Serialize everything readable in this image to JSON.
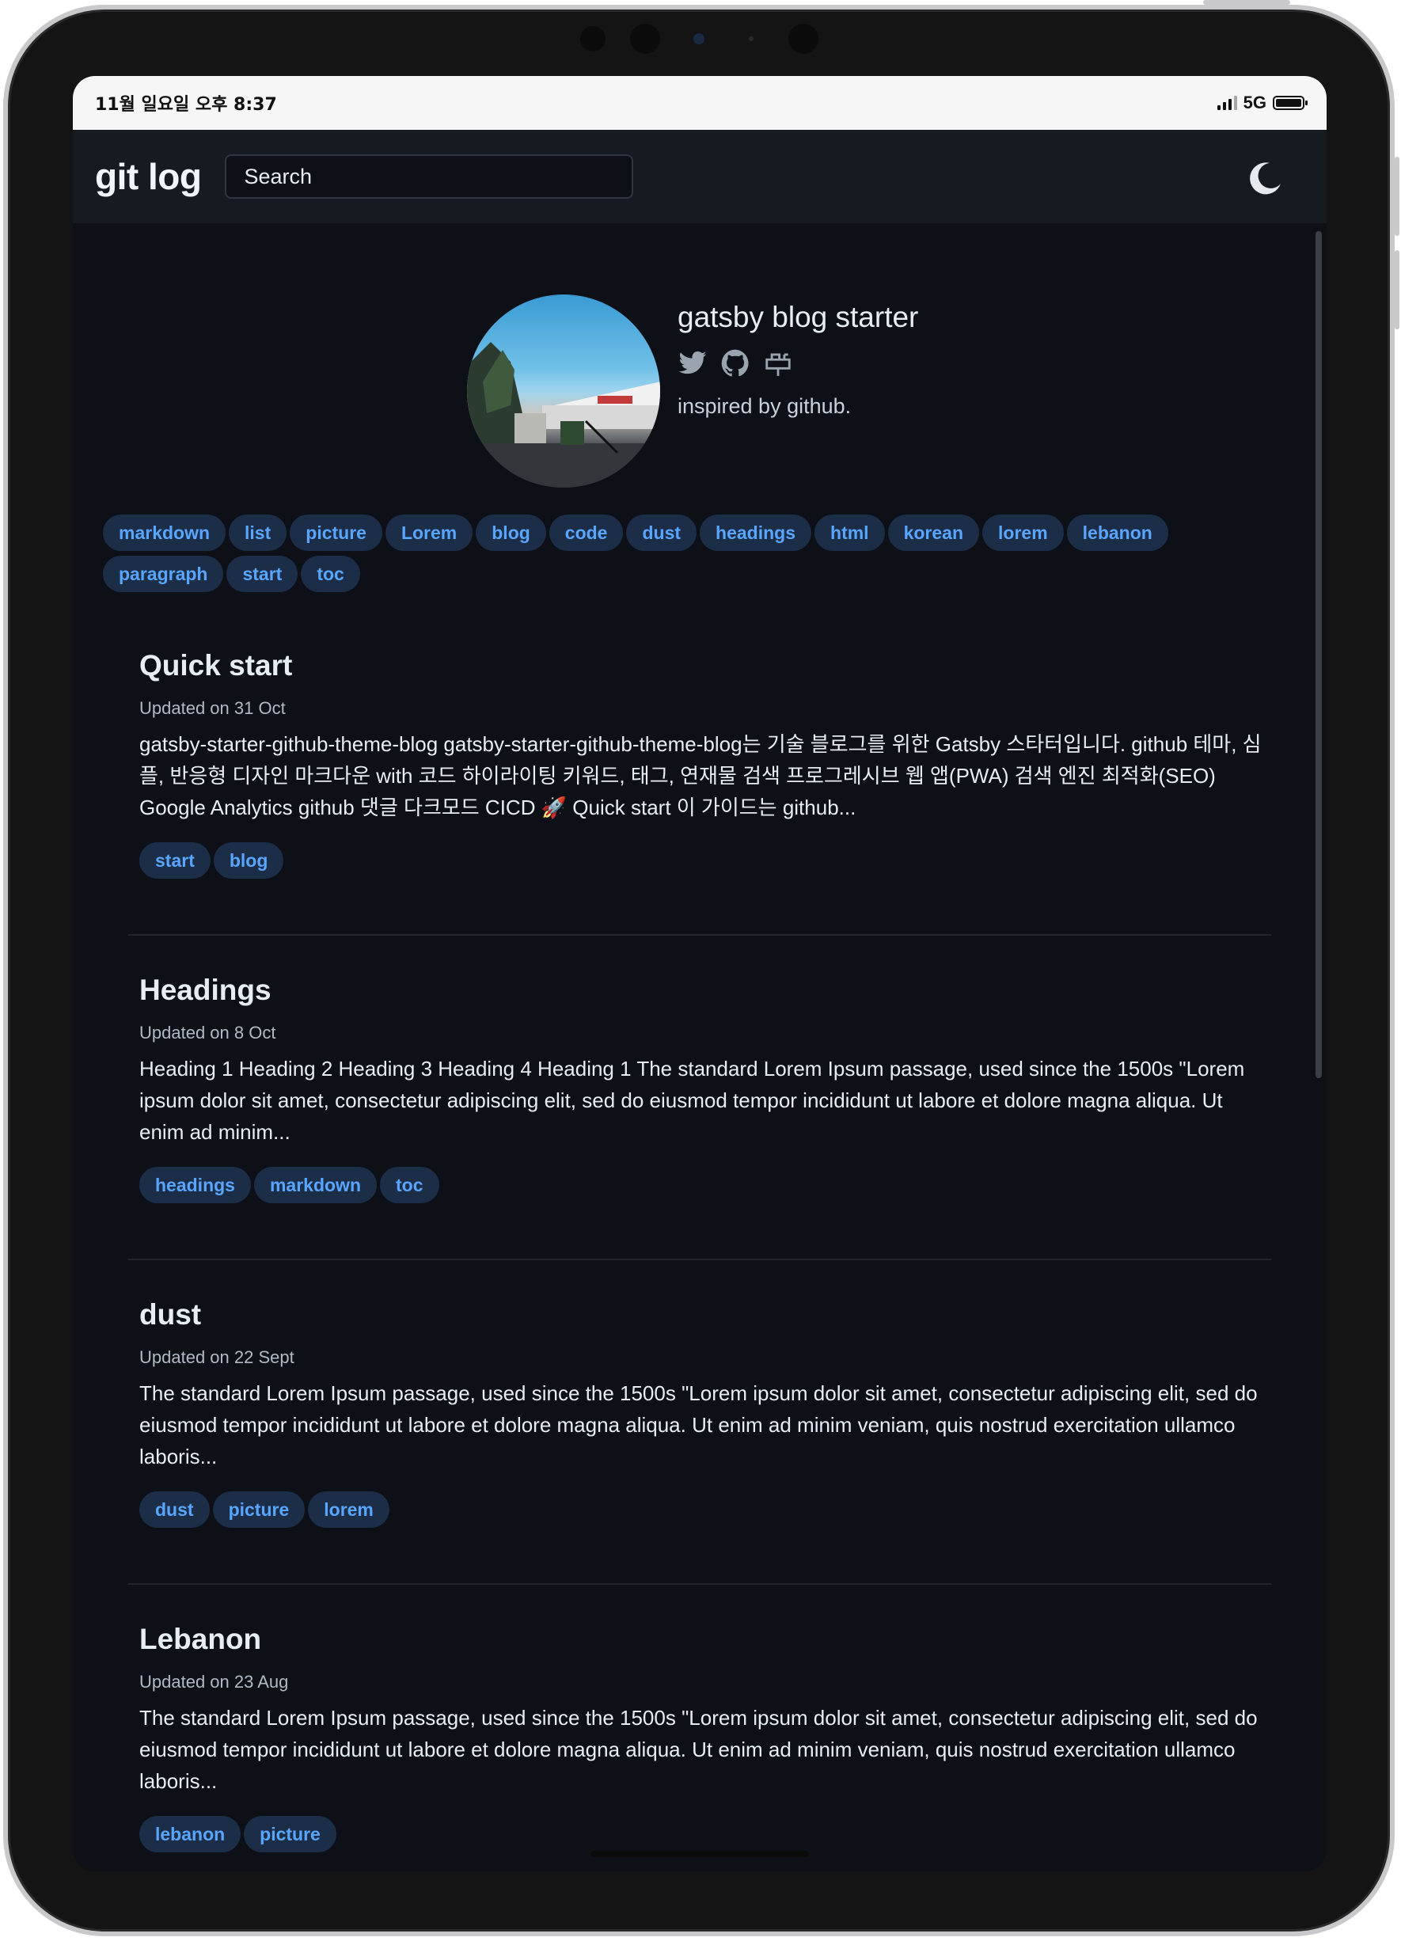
{
  "status_bar": {
    "time": "11월 일요일 오후 8:37",
    "network": "5G",
    "battery_level": 1.0
  },
  "header": {
    "logo": "git log",
    "search_placeholder": "Search",
    "theme_toggle_icon": "moon-icon"
  },
  "profile": {
    "name": "gatsby blog starter",
    "bio": "inspired by github.",
    "social_icons": [
      "twitter-icon",
      "github-icon",
      "mailbox-icon"
    ]
  },
  "tags": [
    "markdown",
    "list",
    "picture",
    "Lorem",
    "blog",
    "code",
    "dust",
    "headings",
    "html",
    "korean",
    "lorem",
    "lebanon",
    "paragraph",
    "start",
    "toc"
  ],
  "posts": [
    {
      "title": "Quick start",
      "date": "Updated on 31 Oct",
      "excerpt": "gatsby-starter-github-theme-blog gatsby-starter-github-theme-blog는 기술 블로그를 위한 Gatsby 스타터입니다. github 테마, 심플, 반응형 디자인 마크다운 with 코드 하이라이팅 키워드, 태그, 연재물 검색 프로그레시브 웹 앱(PWA) 검색 엔진 최적화(SEO) Google Analytics github 댓글 다크모드 CICD 🚀 Quick start 이 가이드는 github...",
      "tags": [
        "start",
        "blog"
      ]
    },
    {
      "title": "Headings",
      "date": "Updated on 8 Oct",
      "excerpt": "Heading 1 Heading 2 Heading 3 Heading 4 Heading 1 The standard Lorem Ipsum passage, used since the 1500s \"Lorem ipsum dolor sit amet, consectetur adipiscing elit, sed do eiusmod tempor incididunt ut labore et dolore magna aliqua. Ut enim ad minim...",
      "tags": [
        "headings",
        "markdown",
        "toc"
      ]
    },
    {
      "title": "dust",
      "date": "Updated on 22 Sept",
      "excerpt": "The standard Lorem Ipsum passage, used since the 1500s \"Lorem ipsum dolor sit amet, consectetur adipiscing elit, sed do eiusmod tempor incididunt ut labore et dolore magna aliqua. Ut enim ad minim veniam, quis nostrud exercitation ullamco laboris...",
      "tags": [
        "dust",
        "picture",
        "lorem"
      ]
    },
    {
      "title": "Lebanon",
      "date": "Updated on 23 Aug",
      "excerpt": "The standard Lorem Ipsum passage, used since the 1500s \"Lorem ipsum dolor sit amet, consectetur adipiscing elit, sed do eiusmod tempor incididunt ut labore et dolore magna aliqua. Ut enim ad minim veniam, quis nostrud exercitation ullamco laboris...",
      "tags": [
        "lebanon",
        "picture"
      ]
    }
  ],
  "colors": {
    "background": "#0d1117",
    "header": "#161b22",
    "tag_bg": "#1c2d48",
    "tag_text": "#58a6ff",
    "text": "#e6edf3"
  }
}
